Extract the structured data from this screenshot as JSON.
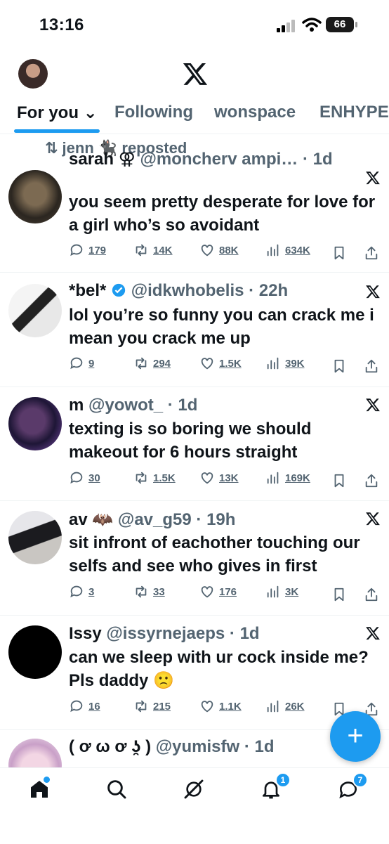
{
  "status_bar": {
    "time": "13:16",
    "time_extra": "lıl\\",
    "battery": "66"
  },
  "tabs": [
    {
      "label": "For you ⌄"
    },
    {
      "label": "Following"
    },
    {
      "label": "wonspace"
    },
    {
      "label": "ENHYPEN"
    }
  ],
  "posts": [
    {
      "repost_text": "⇅ jenn 🐈‍⬛ reposted",
      "name": "sarah ⚢",
      "handle": "@moncherv ampi…",
      "time": "· 1d",
      "text": "you seem pretty desperate for love for a girl who’s so avoidant",
      "replies": "179",
      "reposts": "14K",
      "likes": "88K",
      "views": "634K"
    },
    {
      "name": "*bel*",
      "handle": "@idkwhobelis",
      "time": "· 22h",
      "text": "lol you’re so funny you can crack me i mean you crack me up",
      "replies": "9",
      "reposts": "294",
      "likes": "1.5K",
      "views": "39K"
    },
    {
      "name": "m",
      "handle": "@yowot_",
      "time": "· 1d",
      "text": "texting is so boring we should makeout for 6 hours straight",
      "replies": "30",
      "reposts": "1.5K",
      "likes": "13K",
      "views": "169K"
    },
    {
      "name": "av 🦇",
      "handle": "@av_g59",
      "time": "· 19h",
      "text": "sit infront of eachother touching our selfs and see who gives in first",
      "replies": "3",
      "reposts": "33",
      "likes": "176",
      "views": "3K"
    },
    {
      "name": "Issy",
      "handle": "@issyrnejaeps",
      "time": "· 1d",
      "text": "can we sleep with ur cock inside me? Pls daddy 🙁",
      "replies": "16",
      "reposts": "215",
      "likes": "1.1K",
      "views": "26K"
    },
    {
      "name": "( ơ ω ơ ʖ̯ )",
      "handle": "@yumisfw",
      "time": "· 1d",
      "text": ""
    }
  ],
  "fab": {
    "label": "+"
  },
  "nav": {
    "notifications_badge": "1",
    "messages_badge": "7"
  },
  "colors": {
    "accent": "#1d9bf0",
    "muted": "#536471",
    "text": "#0f1419"
  }
}
